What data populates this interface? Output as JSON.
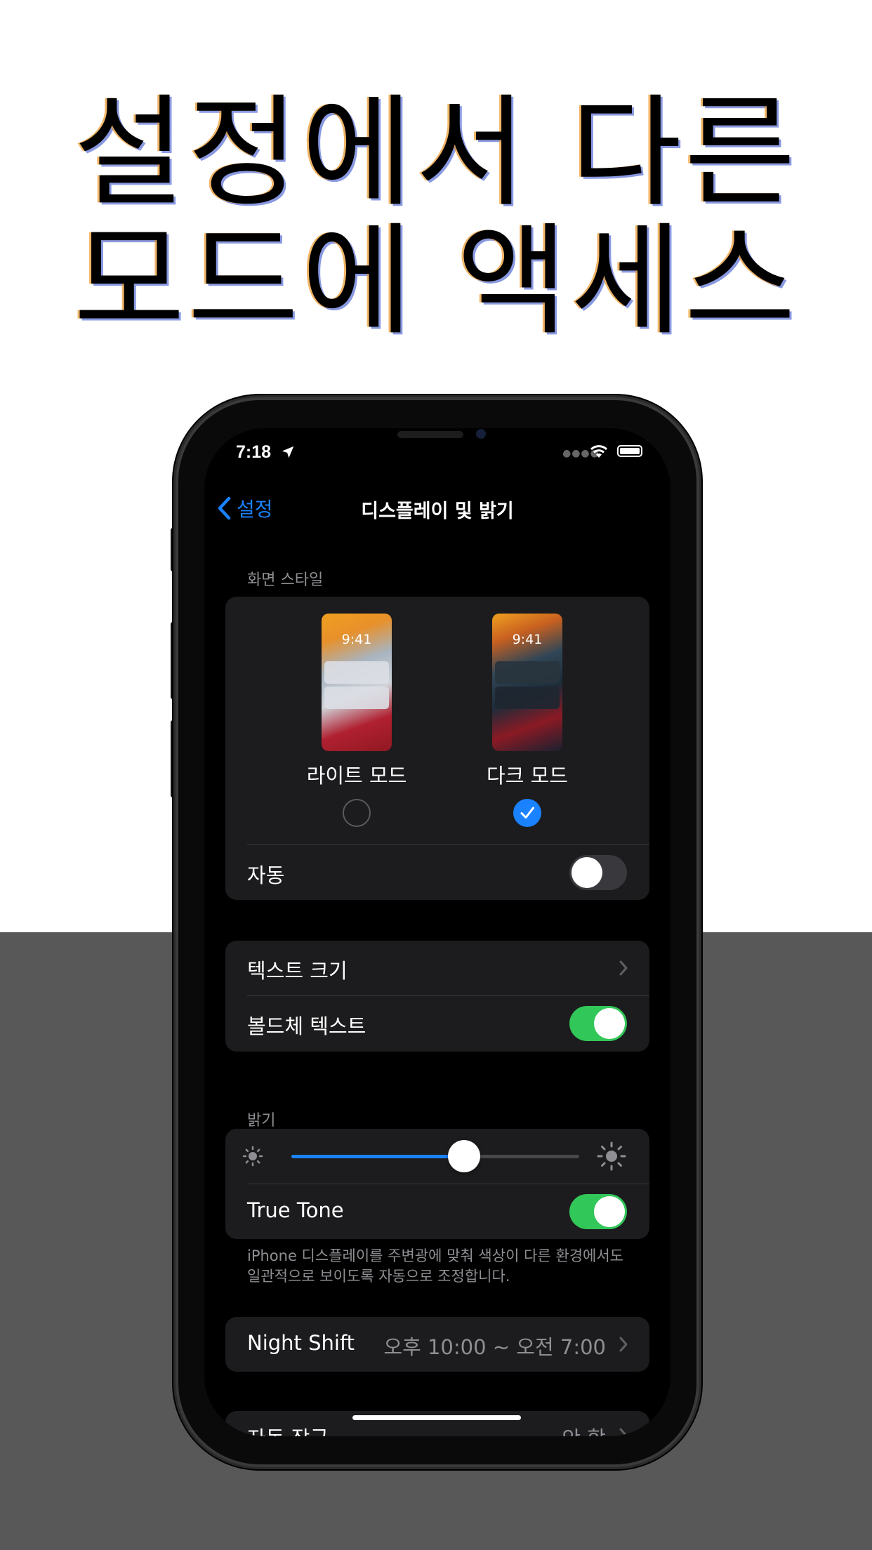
{
  "headline": {
    "line1": "설정에서 다른",
    "line2": "모드에 액세스"
  },
  "status_bar": {
    "time": "7:18"
  },
  "nav": {
    "back_label": "설정",
    "title": "디스플레이 및 밝기"
  },
  "appearance": {
    "section_label": "화면 스타일",
    "preview_time": "9:41",
    "light_label": "라이트 모드",
    "dark_label": "다크 모드",
    "selected": "dark",
    "auto_label": "자동",
    "auto_on": false
  },
  "text_group": {
    "text_size_label": "텍스트 크기",
    "bold_text_label": "볼드체 텍스트",
    "bold_text_on": true
  },
  "brightness": {
    "section_label": "밝기",
    "level": 0.6,
    "true_tone_label": "True Tone",
    "true_tone_on": true,
    "footnote": "iPhone 디스플레이를 주변광에 맞춰 색상이 다른 환경에서도 일관적으로 보이도록 자동으로 조정합니다."
  },
  "night_shift": {
    "label": "Night Shift",
    "value": "오후 10:00 ~ 오전 7:00"
  },
  "auto_lock": {
    "label": "자동 잠금",
    "value": "안 함"
  },
  "colors": {
    "accent": "#1a82ff",
    "toggle_on": "#32c759",
    "cell_background": "#1c1c1e",
    "secondary_text": "#8e8e93"
  }
}
